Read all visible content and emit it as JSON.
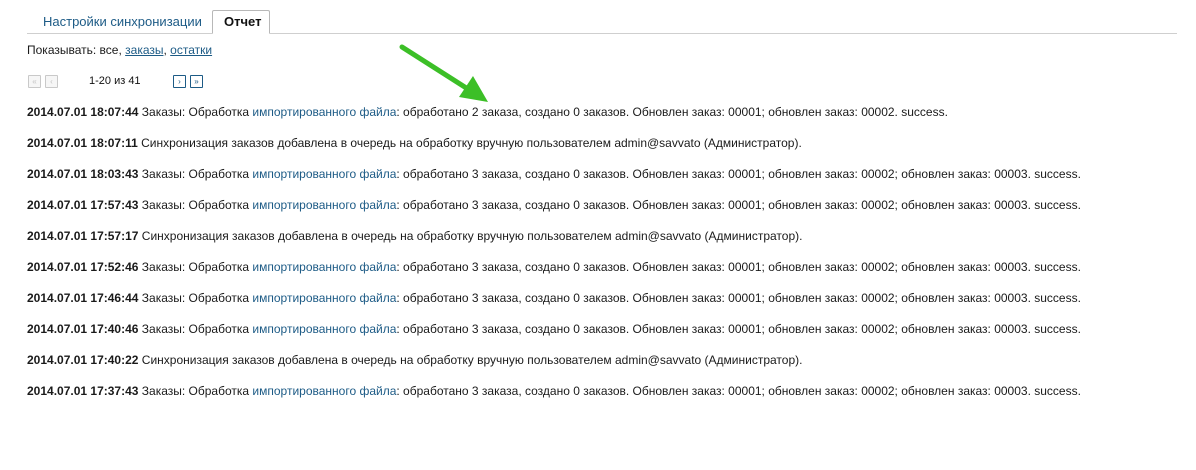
{
  "tabs": {
    "sync_settings": "Настройки синхронизации",
    "report": "Отчет"
  },
  "filter": {
    "prefix": "Показывать: все, ",
    "orders": "заказы",
    "separator": ", ",
    "stock": "остатки"
  },
  "pager": {
    "first": "«",
    "prev": "‹",
    "info": "1-20 из 41",
    "next": "›",
    "last": "»"
  },
  "log": [
    {
      "ts": "2014.07.01 18:07:44",
      "before": " Заказы: Обработка ",
      "link": "импортированного файла",
      "after": ": обработано 2 заказа, создано 0 заказов. Обновлен заказ: 00001; обновлен заказ: 00002. success."
    },
    {
      "ts": "2014.07.01 18:07:11",
      "before": " Синхронизация заказов добавлена в очередь на обработку вручную пользователем admin@savvato (Администратор).",
      "link": "",
      "after": ""
    },
    {
      "ts": "2014.07.01 18:03:43",
      "before": " Заказы: Обработка ",
      "link": "импортированного файла",
      "after": ": обработано 3 заказа, создано 0 заказов. Обновлен заказ: 00001; обновлен заказ: 00002; обновлен заказ: 00003. success."
    },
    {
      "ts": "2014.07.01 17:57:43",
      "before": " Заказы: Обработка ",
      "link": "импортированного файла",
      "after": ": обработано 3 заказа, создано 0 заказов. Обновлен заказ: 00001; обновлен заказ: 00002; обновлен заказ: 00003. success."
    },
    {
      "ts": "2014.07.01 17:57:17",
      "before": " Синхронизация заказов добавлена в очередь на обработку вручную пользователем admin@savvato (Администратор).",
      "link": "",
      "after": ""
    },
    {
      "ts": "2014.07.01 17:52:46",
      "before": " Заказы: Обработка ",
      "link": "импортированного файла",
      "after": ": обработано 3 заказа, создано 0 заказов. Обновлен заказ: 00001; обновлен заказ: 00002; обновлен заказ: 00003. success."
    },
    {
      "ts": "2014.07.01 17:46:44",
      "before": " Заказы: Обработка ",
      "link": "импортированного файла",
      "after": ": обработано 3 заказа, создано 0 заказов. Обновлен заказ: 00001; обновлен заказ: 00002; обновлен заказ: 00003. success."
    },
    {
      "ts": "2014.07.01 17:40:46",
      "before": " Заказы: Обработка ",
      "link": "импортированного файла",
      "after": ": обработано 3 заказа, создано 0 заказов. Обновлен заказ: 00001; обновлен заказ: 00002; обновлен заказ: 00003. success."
    },
    {
      "ts": "2014.07.01 17:40:22",
      "before": " Синхронизация заказов добавлена в очередь на обработку вручную пользователем admin@savvato (Администратор).",
      "link": "",
      "after": ""
    },
    {
      "ts": "2014.07.01 17:37:43",
      "before": " Заказы: Обработка ",
      "link": "импортированного файла",
      "after": ": обработано 3 заказа, создано 0 заказов. Обновлен заказ: 00001; обновлен заказ: 00002; обновлен заказ: 00003. success."
    }
  ],
  "colors": {
    "link": "#1d5b86",
    "arrow": "#3cbf27"
  },
  "icons": {
    "first": "double-left-arrow-icon",
    "prev": "left-arrow-icon",
    "next": "right-arrow-icon",
    "last": "double-right-arrow-icon",
    "annotation": "green-arrow-annotation"
  }
}
